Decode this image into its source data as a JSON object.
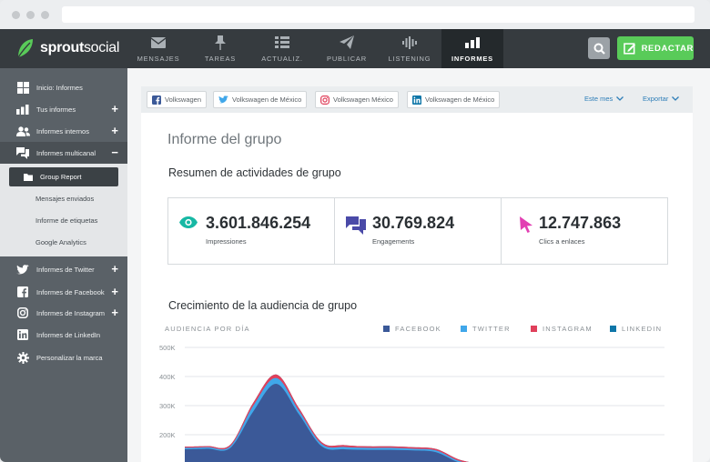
{
  "brand": {
    "name_bold": "sprout",
    "name_light": "social",
    "logo_color": "#59cb59"
  },
  "topnav": {
    "tabs": [
      {
        "label": "MENSAJES",
        "icon": "envelope-icon",
        "active": false
      },
      {
        "label": "TAREAS",
        "icon": "pin-icon",
        "active": false
      },
      {
        "label": "ACTUALIZ.",
        "icon": "list-icon",
        "active": false
      },
      {
        "label": "PUBLICAR",
        "icon": "paper-plane-icon",
        "active": false
      },
      {
        "label": "LISTENING",
        "icon": "soundwave-icon",
        "active": false
      },
      {
        "label": "INFORMES",
        "icon": "bar-chart-icon",
        "active": true
      }
    ],
    "compose_label": "REDACTAR"
  },
  "sidebar": {
    "items": [
      {
        "label": "Inicio: Informes",
        "icon": "grid-icon",
        "plus": ""
      },
      {
        "label": "Tus informes",
        "icon": "bar-chart-icon",
        "plus": "+"
      },
      {
        "label": "Informes internos",
        "icon": "users-icon",
        "plus": "+"
      },
      {
        "label": "Informes multicanal",
        "icon": "chat-icon",
        "plus": "−"
      }
    ],
    "sub_items": [
      "Group Report",
      "Mensajes enviados",
      "Informe de etiquetas",
      "Google Analytics"
    ],
    "items_bottom": [
      {
        "label": "Informes de Twitter",
        "icon": "twitter-icon",
        "plus": "+"
      },
      {
        "label": "Informes de Facebook",
        "icon": "facebook-icon",
        "plus": "+"
      },
      {
        "label": "Informes de Instagram",
        "icon": "instagram-icon",
        "plus": "+"
      },
      {
        "label": "Informes de LinkedIn",
        "icon": "linkedin-icon",
        "plus": ""
      },
      {
        "label": "Personalizar la marca",
        "icon": "gear-icon",
        "plus": ""
      }
    ]
  },
  "filters": {
    "chips": [
      {
        "label": "Volkswagen",
        "network": "facebook"
      },
      {
        "label": "Volkswagen de México",
        "network": "twitter"
      },
      {
        "label": "Volkswagen México",
        "network": "instagram"
      },
      {
        "label": "Volkswagen de México",
        "network": "linkedin"
      }
    ],
    "period": "Este mes",
    "export": "Exportar"
  },
  "report": {
    "title": "Informe del grupo",
    "summary_heading": "Resumen de actividades de grupo",
    "stats": [
      {
        "value": "3.601.846.254",
        "label": "Impressiones",
        "icon": "eye-icon"
      },
      {
        "value": "30.769.824",
        "label": "Engagements",
        "icon": "chat-bubbles-icon"
      },
      {
        "value": "12.747.863",
        "label": "Clics a enlaces",
        "icon": "cursor-icon"
      }
    ],
    "growth_heading": "Crecimiento de la audiencia de grupo"
  },
  "colors": {
    "facebook": "#3b5998",
    "twitter": "#40a7ea",
    "instagram": "#e0405b",
    "linkedin": "#0e76a8",
    "accent_green": "#59cb59"
  },
  "chart_data": {
    "type": "area",
    "title": "AUDIENCIA POR DÍA",
    "ylabel": "",
    "ylim": [
      100000,
      500000
    ],
    "y_ticks": [
      "500K",
      "400K",
      "300K",
      "200K"
    ],
    "x": [
      0,
      1,
      2,
      3,
      4,
      5,
      6,
      7,
      8,
      9,
      10,
      11,
      12,
      13,
      14,
      15,
      16,
      17,
      18,
      19,
      20,
      21
    ],
    "series": [
      {
        "name": "FACEBOOK",
        "color": "#3b5998",
        "values": [
          150000,
          152000,
          155000,
          280000,
          375000,
          270000,
          160000,
          150000,
          148000,
          148000,
          146000,
          140000,
          105000,
          90000,
          80000,
          75000,
          75000,
          75000,
          75000,
          75000,
          75000,
          75000
        ]
      },
      {
        "name": "TWITTER",
        "color": "#40a7ea",
        "values": [
          5000,
          5000,
          6000,
          20000,
          20000,
          12000,
          8000,
          8000,
          7000,
          7000,
          6000,
          6000,
          5000,
          5000,
          5000,
          5000,
          5000,
          5000,
          5000,
          5000,
          5000,
          5000
        ]
      },
      {
        "name": "INSTAGRAM",
        "color": "#e0405b",
        "values": [
          4000,
          4000,
          5000,
          10000,
          12000,
          9000,
          6000,
          6000,
          5000,
          5000,
          5000,
          5000,
          5000,
          4000,
          4000,
          4000,
          4000,
          4000,
          4000,
          4000,
          4000,
          4000
        ]
      },
      {
        "name": "LINKEDIN",
        "color": "#0e76a8",
        "values": [
          0,
          0,
          0,
          0,
          0,
          0,
          0,
          0,
          0,
          0,
          0,
          0,
          0,
          0,
          0,
          0,
          0,
          0,
          0,
          0,
          0,
          0
        ]
      }
    ],
    "grid": true,
    "legend": "top-right"
  }
}
